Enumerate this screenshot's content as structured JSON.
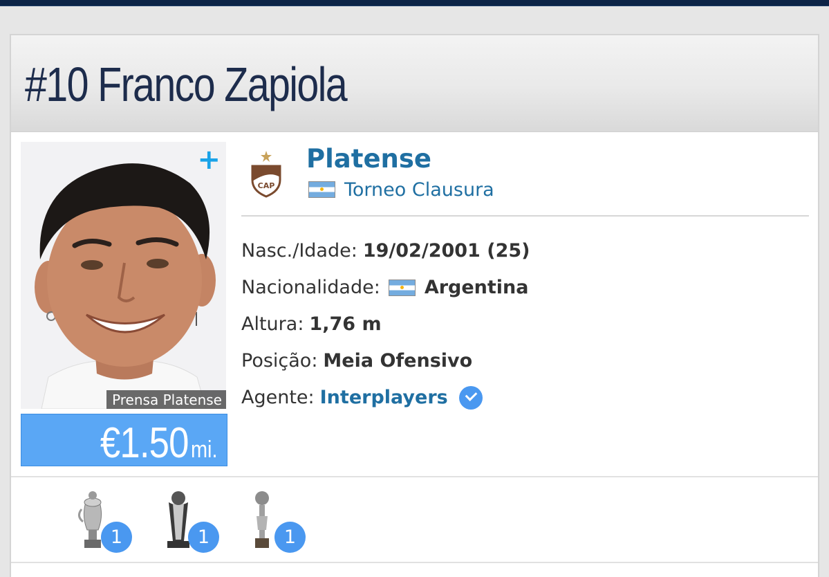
{
  "header": {
    "number": "#10",
    "first_name": "Franco",
    "last_name": "Zapiola"
  },
  "photo": {
    "add_icon": "plus-icon",
    "plus": "+",
    "credit": "Prensa Platense"
  },
  "market_value": {
    "amount": "€1.50",
    "unit": "mi."
  },
  "club": {
    "name": "Platense",
    "logo_text": "CAP",
    "league": "Torneo Clausura",
    "league_flag": "argentina-flag-icon"
  },
  "details": [
    {
      "label": "Nasc./Idade:",
      "value": "19/02/2001 (25)"
    },
    {
      "label": "Nacionalidade:",
      "value": "Argentina",
      "flag": "argentina-flag-icon"
    },
    {
      "label": "Altura:",
      "value": "1,76 m"
    },
    {
      "label": "Posição:",
      "value": "Meia Ofensivo"
    },
    {
      "label": "Agente:",
      "value": "Interplayers",
      "icon": "verified-check-icon"
    }
  ],
  "trophies": [
    {
      "icon": "trophy-icon",
      "count": "1"
    },
    {
      "icon": "trophy-icon",
      "count": "1"
    },
    {
      "icon": "trophy-icon",
      "count": "1"
    }
  ],
  "colors": {
    "accent_blue": "#1f6fa2",
    "value_box": "#5aa7f5",
    "badge": "#4a98f0",
    "title": "#1d2c4c",
    "topbar": "#0d2447"
  }
}
